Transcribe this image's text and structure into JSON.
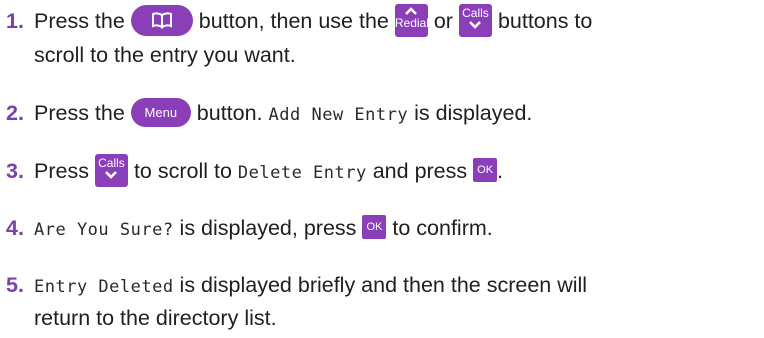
{
  "steps": [
    {
      "number": "1.",
      "parts": {
        "a": "Press the",
        "b": "button, then use the",
        "c": "or",
        "d": "buttons to",
        "e": "scroll to the entry you want."
      }
    },
    {
      "number": "2.",
      "parts": {
        "a": "Press the",
        "b": "button.",
        "lcd": "Add New Entry",
        "c": "is displayed."
      }
    },
    {
      "number": "3.",
      "parts": {
        "a": "Press",
        "b": "to scroll to",
        "lcd": "Delete Entry",
        "c": "and press",
        "d": "."
      }
    },
    {
      "number": "4.",
      "parts": {
        "lcd": "Are You Sure?",
        "a": "is displayed, press",
        "b": "to confirm."
      }
    },
    {
      "number": "5.",
      "parts": {
        "lcd": "Entry Deleted",
        "a": "is displayed briefly and then the screen will",
        "b": "return to the directory list."
      }
    }
  ],
  "buttons": {
    "redial_label": "Redial",
    "calls_label": "Calls",
    "menu_label": "Menu",
    "ok_label": "OK",
    "phonebook_icon": "book-icon",
    "up_icon": "chevron-up-icon",
    "down_icon": "chevron-down-icon"
  },
  "colors": {
    "accent": "#8a3fb8",
    "number": "#7b3fb0",
    "text": "#1f1f1f"
  }
}
